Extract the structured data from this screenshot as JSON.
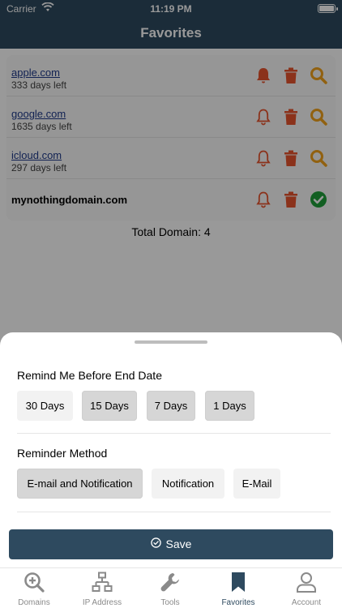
{
  "status_bar": {
    "carrier": "Carrier",
    "time": "11:19 PM"
  },
  "header": {
    "title": "Favorites"
  },
  "domains": [
    {
      "name": "apple.com",
      "days_left": "333 days left",
      "bell_filled": true,
      "status": "search"
    },
    {
      "name": "google.com",
      "days_left": "1635 days left",
      "bell_filled": false,
      "status": "search"
    },
    {
      "name": "icloud.com",
      "days_left": "297 days left",
      "bell_filled": false,
      "status": "search"
    },
    {
      "name": "mynothingdomain.com",
      "days_left": "",
      "bell_filled": false,
      "status": "available"
    }
  ],
  "total_label": "Total Domain: 4",
  "sheet": {
    "remind_title": "Remind Me Before End Date",
    "remind_options": [
      "30 Days",
      "15 Days",
      "7 Days",
      "1 Days"
    ],
    "method_title": "Reminder Method",
    "method_options": [
      "E-mail and Notification",
      "Notification",
      "E-Mail"
    ],
    "save_label": "Save"
  },
  "tabs": [
    {
      "label": "Domains",
      "icon": "zoom-in-icon",
      "active": false
    },
    {
      "label": "IP Address",
      "icon": "network-icon",
      "active": false
    },
    {
      "label": "Tools",
      "icon": "wrench-icon",
      "active": false
    },
    {
      "label": "Favorites",
      "icon": "bookmark-icon",
      "active": true
    },
    {
      "label": "Account",
      "icon": "user-icon",
      "active": false
    }
  ],
  "colors": {
    "primary": "#2e4a5f",
    "bell": "#e8542e",
    "trash": "#e8542e",
    "search": "#f2a21b",
    "available": "#1f9e3a"
  }
}
